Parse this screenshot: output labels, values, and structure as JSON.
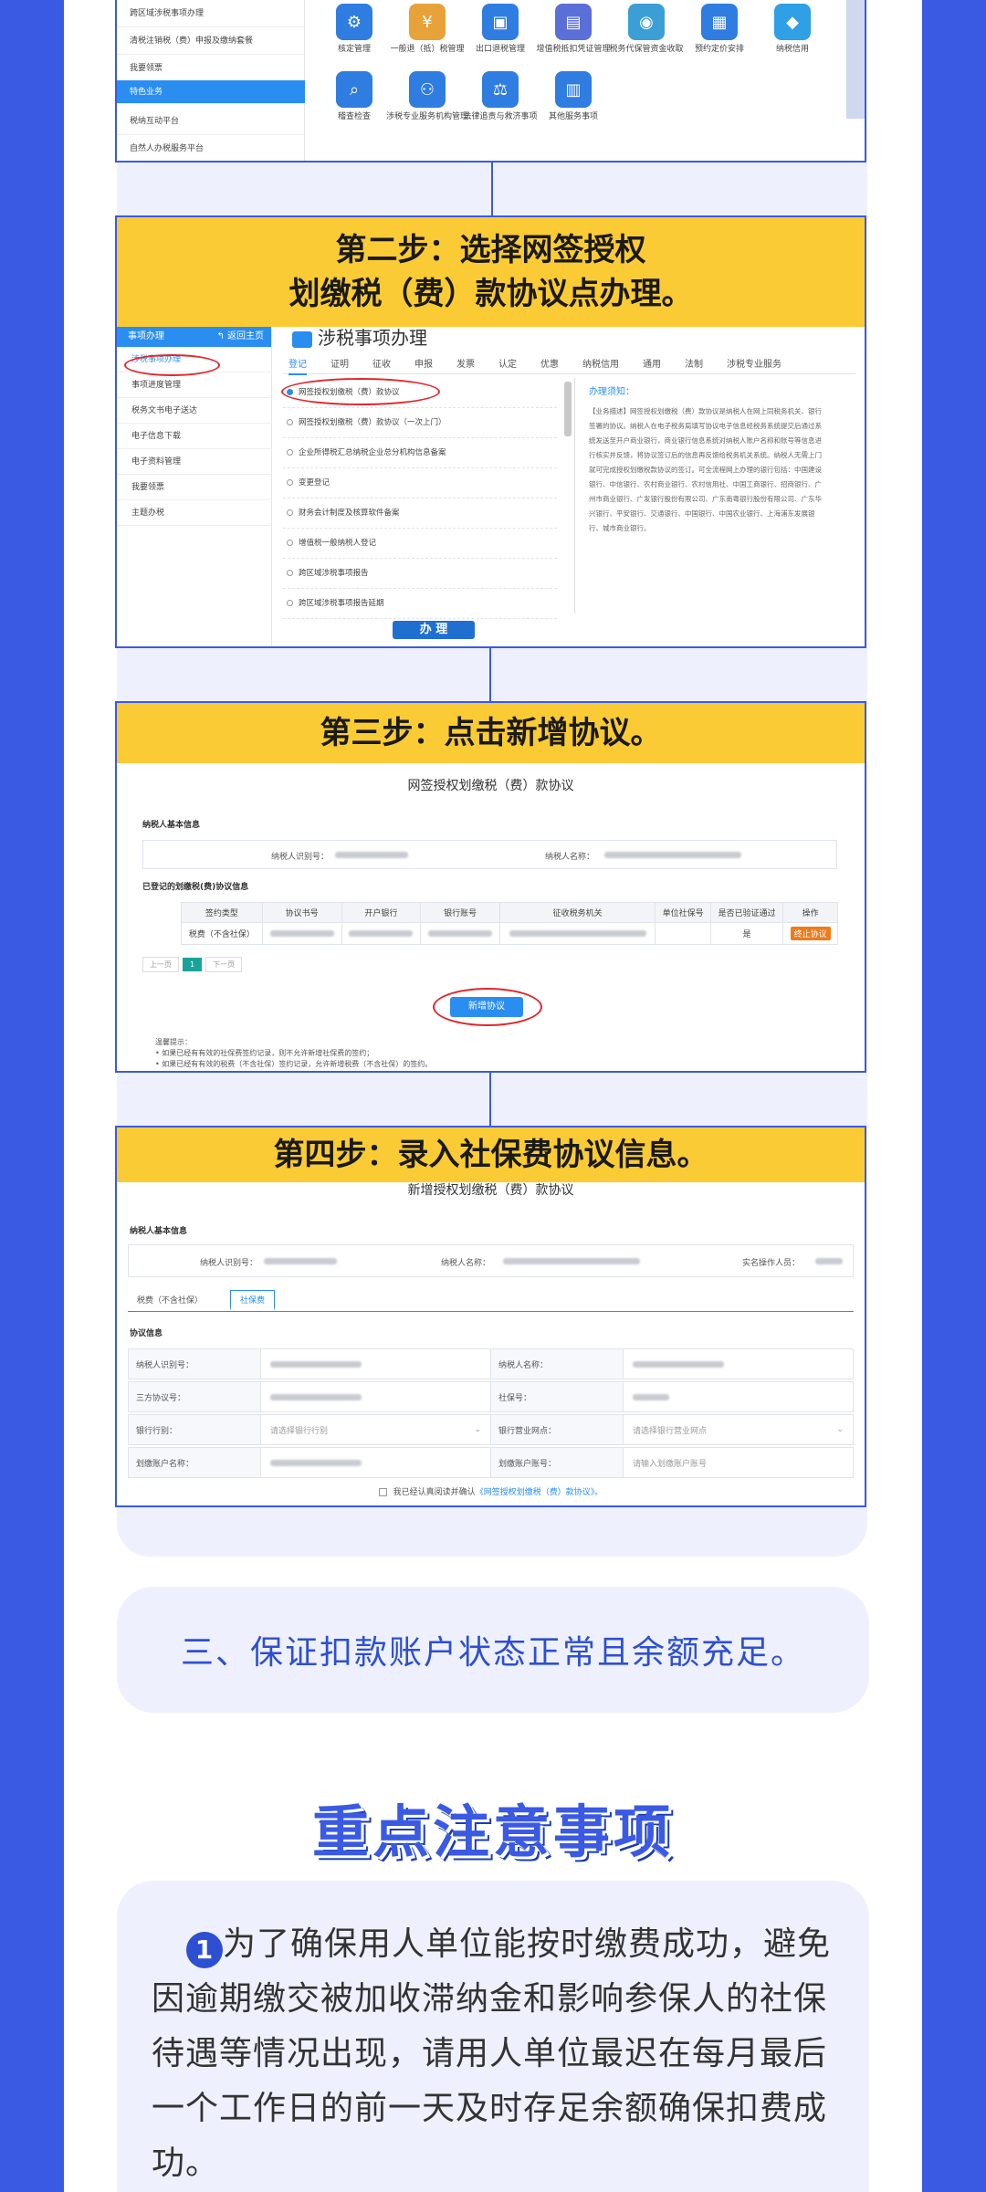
{
  "step1": {
    "sidebar": [
      "跨区域涉税事项办理",
      "清税注销税（费）申报及缴纳套餐",
      "我要领票",
      "特色业务",
      "税纳互动平台",
      "自然人办税服务平台"
    ],
    "icons": [
      {
        "name": "核定管理",
        "icon": "shield-person-icon"
      },
      {
        "name": "一般退（抵）税管理",
        "icon": "refund-icon"
      },
      {
        "name": "出口退税管理",
        "icon": "export-refund-icon"
      },
      {
        "name": "增值税抵扣凭证管理",
        "icon": "voucher-icon"
      },
      {
        "name": "税务代保管资金收取",
        "icon": "money-bag-icon"
      },
      {
        "name": "预约定价安排",
        "icon": "calendar-icon"
      },
      {
        "name": "纳税信用",
        "icon": "credit-badge-icon"
      },
      {
        "name": "稽查检查",
        "icon": "inspect-icon"
      },
      {
        "name": "涉税专业服务机构管理",
        "icon": "agency-icon"
      },
      {
        "name": "法律追责与救济事项",
        "icon": "gavel-icon"
      },
      {
        "name": "其他服务事项",
        "icon": "other-service-icon"
      }
    ]
  },
  "step2": {
    "title_line1": "第二步：选择网签授权",
    "title_line2": "划缴税（费）款协议点办理。",
    "sidebar_header": "事项办理",
    "sidebar_back": "返回主页",
    "sidebar": [
      "涉税事项办理",
      "事项进度管理",
      "税务文书电子送达",
      "电子信息下载",
      "电子资料管理",
      "我要领票",
      "主题办税"
    ],
    "page_title": "涉税事项办理",
    "tabs": [
      "登记",
      "证明",
      "征收",
      "申报",
      "发票",
      "认定",
      "优惠",
      "纳税信用",
      "通用",
      "法制",
      "涉税专业服务"
    ],
    "items": [
      "网签授权划缴税（费）款协议",
      "网签授权划缴税（费）款协议（一次上门）",
      "企业所得税汇总纳税企业总分机构信息备案",
      "变更登记",
      "财务会计制度及核算软件备案",
      "增值税一般纳税人登记",
      "跨区域涉税事项报告",
      "跨区域涉税事项报告延期"
    ],
    "notice_title": "办理须知：",
    "notice_text": "【业务描述】网签授权划缴税（费）款协议是纳税人在网上同税务机关、银行签署的协议。纳税人在电子税务局填写协议电子信息经税务系统提交后通过系统发送至开户商业银行，商业银行信息系统对纳税人账户名称和账号等信息进行核实并反馈，将协议签订后的信息再反馈给税务机关系统。纳税人无需上门就可完成授权划缴税款协议的签订。可全流程网上办理的银行包括：中国建设银行、中信银行、农村商业银行、农村信用社、中国工商银行、招商银行、广州市商业银行、广发银行股份有限公司、广东南粤银行股份有限公司、广东华兴银行、平安银行、交通银行、中国银行、中国农业银行、上海浦东发展银行、城市商业银行。",
    "handle_button": "办 理"
  },
  "step3": {
    "title": "第三步：点击新增协议。",
    "form_title": "网签授权划缴税（费）款协议",
    "section1": "纳税人基本信息",
    "taxpayer_id_label": "纳税人识别号：",
    "taxpayer_name_label": "纳税人名称：",
    "section2": "已登记的划缴税(费)协议信息",
    "columns": [
      "签约类型",
      "协议书号",
      "开户银行",
      "银行账号",
      "征收税务机关",
      "单位社保号",
      "是否已验证通过",
      "操作"
    ],
    "row_type": "税费（不含社保）",
    "row_verified": "是",
    "row_action": "终止协议",
    "pager": [
      "上一页",
      "1",
      "下一页"
    ],
    "add_button": "新增协议",
    "tips_title": "温馨提示：",
    "tips": [
      "如果已经有有效的社保费签约记录，则不允许新增社保费的签约；",
      "如果已经有有效的税费（不含社保）签约记录，允许新增税费（不含社保）的签约。"
    ]
  },
  "step4": {
    "title": "第四步：录入社保费协议信息。",
    "form_title": "新增授权划缴税（费）款协议",
    "section1": "纳税人基本信息",
    "taxpayer_id_label": "纳税人识别号：",
    "taxpayer_name_label": "纳税人名称：",
    "operator_label": "实名操作人员：",
    "tabs": [
      "税费（不含社保）",
      "社保费"
    ],
    "section2": "协议信息",
    "rows": [
      [
        "纳税人识别号：",
        "",
        "纳税人名称：",
        ""
      ],
      [
        "三方协议号：",
        "",
        "社保号：",
        ""
      ],
      [
        "银行行别：",
        "请选择银行行别",
        "银行营业网点：",
        "请选择银行营业网点"
      ],
      [
        "划缴账户名称：",
        "",
        "划缴账户账号：",
        "请输入划缴账户账号"
      ]
    ],
    "agree_prefix": "我已经认真阅读并确认",
    "agree_link": "《网签授权划缴税（费）款协议》。"
  },
  "section3": {
    "text": "三、保证扣款账户状态正常且余额充足。"
  },
  "notes": {
    "title": "重点注意事项",
    "number": "1",
    "text": "为了确保用人单位能按时缴费成功，避免因逾期缴交被加收滞纳金和影响参保人的社保待遇等情况出现，请用人单位最迟在每月最后一个工作日的前一天及时存足余额确保扣费成功。"
  }
}
